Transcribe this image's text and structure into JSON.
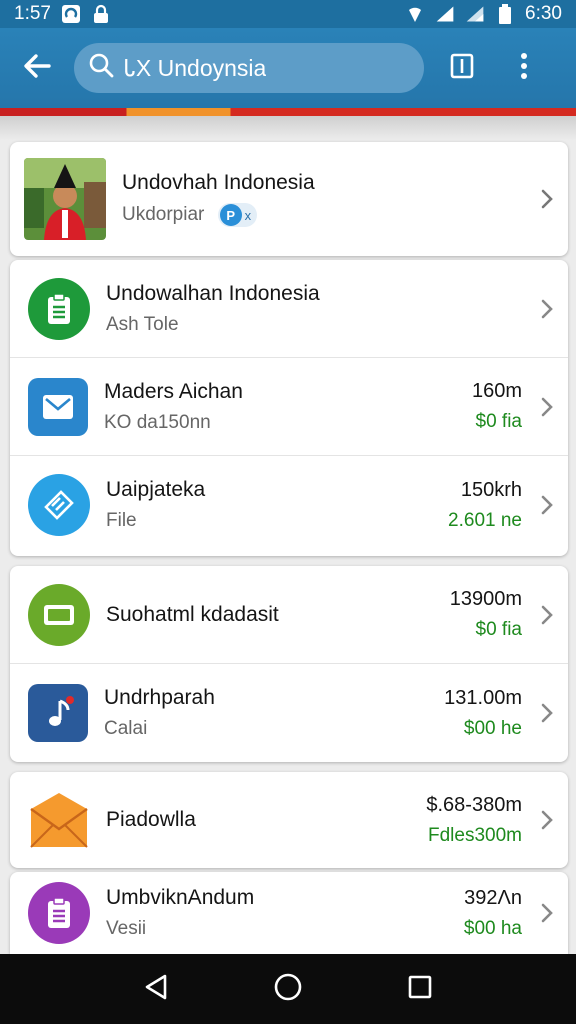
{
  "status_bar": {
    "time_left": "1:57",
    "time_right": "6:30",
    "icons": [
      "chat-app-icon",
      "lock-icon",
      "wifi-icon",
      "signal-icon",
      "signal-icon",
      "battery-icon"
    ]
  },
  "app_bar": {
    "search_text": "ᏓX Undoynsia",
    "icons": [
      "back-arrow-icon",
      "search-icon",
      "tab-icon",
      "overflow-menu-icon"
    ]
  },
  "profile": {
    "name": "Undovhah Indonesia",
    "subtitle": "Ukdorpiar",
    "chip_letter": "P",
    "chip_close": "x"
  },
  "group1": [
    {
      "title": "Undowalhan Indonesia",
      "subtitle": "Ash Tole",
      "amount": "",
      "green": "",
      "icon": "clipboard-icon",
      "color": "#1e9a3a"
    },
    {
      "title": "Maders Aichan",
      "subtitle": "KO da150nn",
      "amount": "160m",
      "green": "$0 fia",
      "icon": "mail-icon",
      "color": "#2a86cc"
    },
    {
      "title": "Uaipjateka",
      "subtitle": "File",
      "amount": "150krh",
      "green": "2.601 ne",
      "icon": "layers-icon",
      "color": "#2aa2e4"
    }
  ],
  "group2": [
    {
      "title": "Suohatml kdadasit",
      "subtitle": "",
      "amount": "13900m",
      "green": "$0 fia",
      "icon": "card-icon",
      "color": "#6aaa2a"
    },
    {
      "title": "Undrhparah",
      "subtitle": "Calai",
      "amount": "131.00m",
      "green": "$00 he",
      "icon": "music-note-icon",
      "color": "#2a5a9a"
    }
  ],
  "group3": [
    {
      "title": "Piadowlla",
      "subtitle": "",
      "amount": "$.68-380m",
      "green": "Fdles300m",
      "icon": "envelope-icon",
      "color": "#ee8a22"
    }
  ],
  "group4": [
    {
      "title": "UmbviknAndum",
      "subtitle": "Vesii",
      "amount": "392Λn",
      "green": "$00 ha",
      "icon": "clipboard-icon",
      "color": "#9a3ab8"
    }
  ],
  "nav_bar": {
    "icons": [
      "back-triangle-icon",
      "home-circle-icon",
      "recents-square-icon"
    ]
  }
}
